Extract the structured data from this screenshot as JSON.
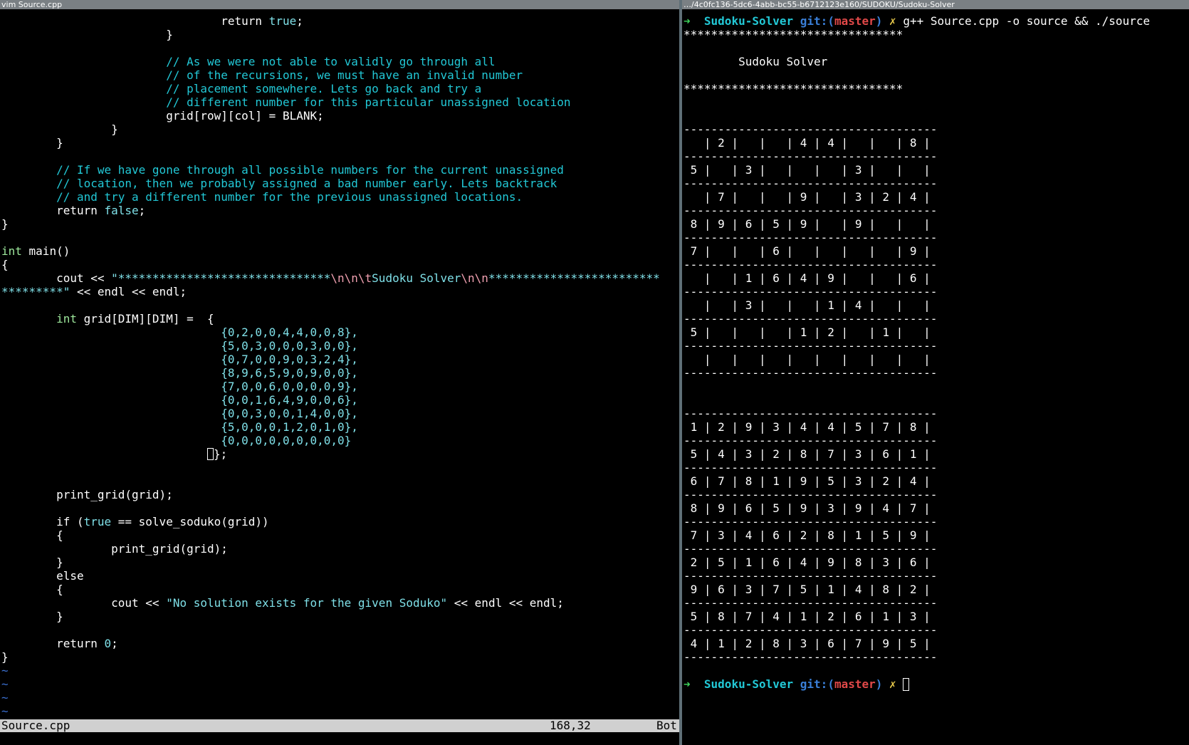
{
  "left_pane": {
    "title": "vim Source.cpp",
    "code": {
      "l1_ret": "return ",
      "l1_true": "true",
      "l1_semi": ";",
      "brace_close": "}",
      "c1": "// As we were not able to validly go through all",
      "c2": "// of the recursions, we must have an invalid number",
      "c3": "// placement somewhere. Lets go back and try a",
      "c4": "// different number for this particular unassigned location",
      "blank_assign": "grid[row][col] = BLANK;",
      "c5": "// If we have gone through all possible numbers for the current unassigned",
      "c6": "// location, then we probably assigned a bad number early. Lets backtrack",
      "c7": "// and try a different number for the previous unassigned locations.",
      "ret": "return ",
      "false_kw": "false",
      "semi": ";",
      "int_kw": "int",
      "main_sig": " main()",
      "brace_open": "{",
      "cout1_pre": "cout << ",
      "cout1_str_a": "\"*******************************",
      "cout1_esc_a": "\\n\\n\\t",
      "cout1_str_b": "Sudoku Solver",
      "cout1_esc_b": "\\n\\n",
      "cout1_str_c": "*************************",
      "cout1_wrap": "*********\"",
      "cout1_tail": " << endl << endl;",
      "grid_decl_rest": " grid[DIM][DIM] =  {",
      "grid_rows": [
        "{0,2,0,0,4,4,0,0,8},",
        "{5,0,3,0,0,0,3,0,0},",
        "{0,7,0,0,9,0,3,2,4},",
        "{8,9,6,5,9,0,9,0,0},",
        "{7,0,0,6,0,0,0,0,9},",
        "{0,0,1,6,4,9,0,0,6},",
        "{0,0,3,0,0,1,4,0,0},",
        "{5,0,0,0,1,2,0,1,0},",
        "{0,0,0,0,0,0,0,0,0}"
      ],
      "grid_close": "};",
      "print_grid": "print_grid(grid);",
      "if_kw": "if",
      "if_open": " (",
      "if_true": "true",
      "if_rest": " == solve_soduko(grid))",
      "else_kw": "else",
      "cout2_pre": "cout << ",
      "cout2_str": "\"No solution exists for the given Soduko\"",
      "cout2_tail": " << endl << endl;",
      "return_kw": "return ",
      "zero": "0",
      "tilde": "~"
    },
    "statusline": {
      "filename": "Source.cpp",
      "position": "168,32",
      "scroll": "Bot"
    }
  },
  "right_pane": {
    "title": "…/4c0fc136-5dc6-4abb-bc55-b6712123e160/SUDOKU/Sudoku-Solver",
    "prompt": {
      "arrow": "➜",
      "dir": "Sudoku-Solver",
      "git": "git:(",
      "branch": "master",
      "git_close": ")",
      "dirty": "✗",
      "command": "g++ Source.cpp -o source && ./source"
    },
    "banner_stars": "********************************",
    "banner_title": "Sudoku Solver",
    "separator": "-------------------------------------",
    "puzzle_rows": [
      "   | 2 |   |   | 4 | 4 |   |   | 8 |",
      " 5 |   | 3 |   |   |   | 3 |   |   |",
      "   | 7 |   |   | 9 |   | 3 | 2 | 4 |",
      " 8 | 9 | 6 | 5 | 9 |   | 9 |   |   |",
      " 7 |   |   | 6 |   |   |   |   | 9 |",
      "   |   | 1 | 6 | 4 | 9 |   |   | 6 |",
      "   |   | 3 |   |   | 1 | 4 |   |   |",
      " 5 |   |   |   | 1 | 2 |   | 1 |   |",
      "   |   |   |   |   |   |   |   |   |"
    ],
    "solution_rows": [
      " 1 | 2 | 9 | 3 | 4 | 4 | 5 | 7 | 8 |",
      " 5 | 4 | 3 | 2 | 8 | 7 | 3 | 6 | 1 |",
      " 6 | 7 | 8 | 1 | 9 | 5 | 3 | 2 | 4 |",
      " 8 | 9 | 6 | 5 | 9 | 3 | 9 | 4 | 7 |",
      " 7 | 3 | 4 | 6 | 2 | 8 | 1 | 5 | 9 |",
      " 2 | 5 | 1 | 6 | 4 | 9 | 8 | 3 | 6 |",
      " 9 | 6 | 3 | 7 | 5 | 1 | 4 | 8 | 2 |",
      " 5 | 8 | 7 | 4 | 1 | 2 | 6 | 1 | 3 |",
      " 4 | 1 | 2 | 8 | 3 | 6 | 7 | 9 | 5 |"
    ]
  }
}
